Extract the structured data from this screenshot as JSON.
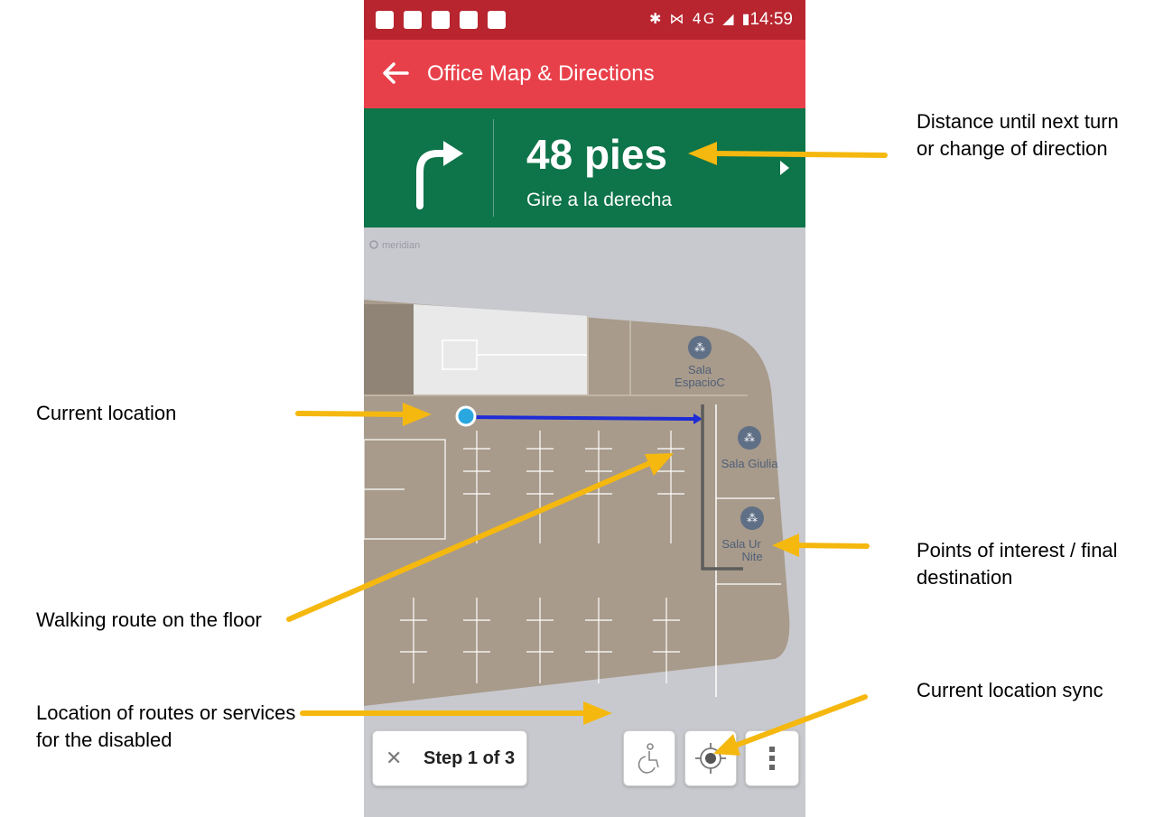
{
  "status_bar": {
    "time": "14:59",
    "right_icons": "✱ ⋈ 4G ◢ ▮"
  },
  "app_bar": {
    "title": "Office Map & Directions"
  },
  "nav_banner": {
    "distance": "48 pies",
    "instruction": "Gire a la derecha"
  },
  "map": {
    "watermark": "meridian",
    "rooms": [
      {
        "line1": "Sala",
        "line2": "EspacioC",
        "icon": "group-icon"
      },
      {
        "line1": "Sala Giulia",
        "line2": "",
        "icon": "group-icon"
      },
      {
        "line1": "Sala Ur",
        "line2": "Nite",
        "icon": "group-icon"
      }
    ]
  },
  "bottom_bar": {
    "step_label": "Step 1 of 3",
    "close_icon": "close-icon",
    "accessibility_icon": "wheelchair-icon",
    "locate_icon": "locate-icon",
    "more_icon": "more-vert-icon"
  },
  "annotations": {
    "distance": "Distance until next turn or change of direction",
    "current_location": "Current location",
    "poi": "Points of interest / final destination",
    "walking_route": "Walking route on the floor",
    "location_sync": "Current location sync",
    "disabled_routes": "Location of routes or services for the disabled"
  },
  "colors": {
    "status_bar": "#b8252f",
    "app_bar": "#e8404a",
    "nav_banner": "#0e7449",
    "arrow": "#f5b80f",
    "route": "#1f2bd6",
    "floor": "#a89b8b"
  }
}
